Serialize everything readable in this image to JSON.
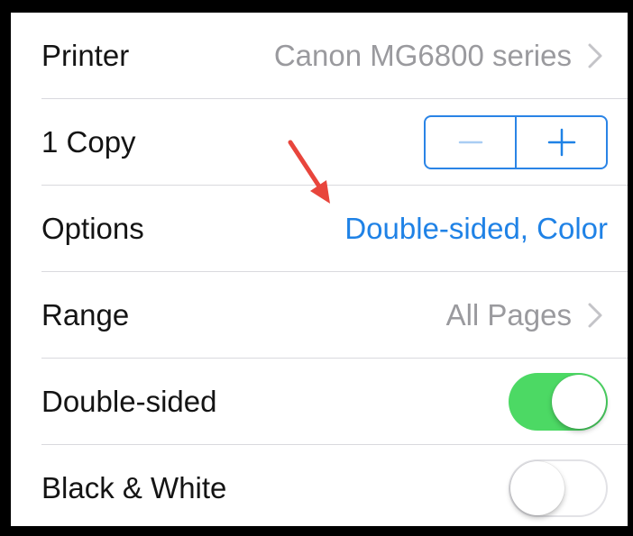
{
  "print_options": {
    "printer": {
      "label": "Printer",
      "value": "Canon MG6800 series",
      "chevron_icon": "chevron-right-icon"
    },
    "copies": {
      "label": "1 Copy",
      "decrement_icon": "minus-icon",
      "increment_icon": "plus-icon"
    },
    "options": {
      "label": "Options",
      "value": "Double-sided, Color"
    },
    "range": {
      "label": "Range",
      "value": "All Pages",
      "chevron_icon": "chevron-right-icon"
    },
    "double_sided": {
      "label": "Double-sided",
      "on": true
    },
    "black_white": {
      "label": "Black & White",
      "on": false
    }
  },
  "annotation": {
    "arrow_icon": "red-arrow-icon"
  },
  "colors": {
    "accent_blue": "#1f82e6",
    "toggle_on_green": "#4cd964",
    "secondary_text": "#9a9a9e",
    "arrow_red": "#e8453c"
  }
}
